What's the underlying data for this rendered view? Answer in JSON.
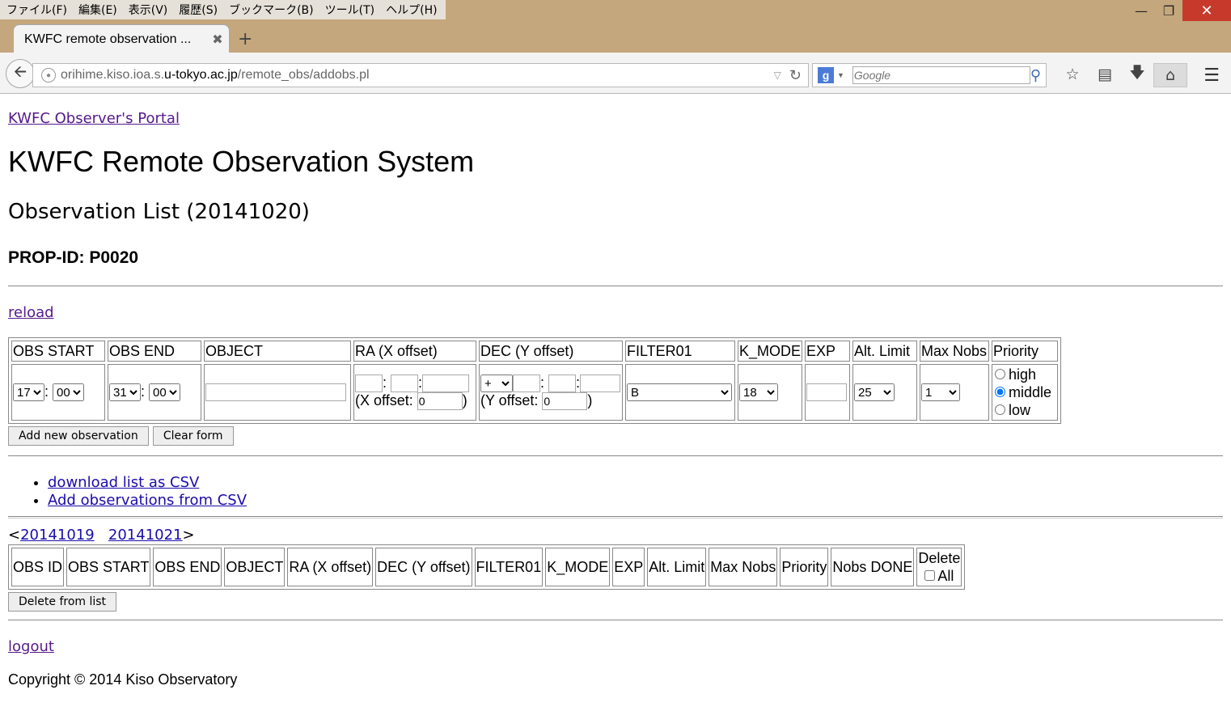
{
  "browser": {
    "menu": [
      "ファイル(F)",
      "編集(E)",
      "表示(V)",
      "履歴(S)",
      "ブックマーク(B)",
      "ツール(T)",
      "ヘルプ(H)"
    ],
    "tab_title": "KWFC remote observation ...",
    "url_host_dim": "orihime.kiso.ioa.s.",
    "url_host": "u-tokyo.ac.jp",
    "url_path": "/remote_obs/addobs.pl",
    "search_placeholder": "Google"
  },
  "page": {
    "portal_link": "KWFC Observer's Portal",
    "title": "KWFC Remote Observation System",
    "subtitle": "Observation List (20141020)",
    "prop_id": "PROP-ID: P0020",
    "reload": "reload"
  },
  "form": {
    "headers": [
      "OBS START",
      "OBS END",
      "OBJECT",
      "RA (X offset)",
      "DEC (Y offset)",
      "FILTER01",
      "K_MODE",
      "EXP",
      "Alt. Limit",
      "Max Nobs",
      "Priority"
    ],
    "obs_start_hour": "17",
    "obs_start_min": "00",
    "obs_end_hour": "31",
    "obs_end_min": "00",
    "x_offset_label": "(X offset:",
    "x_offset_value": "0",
    "dec_sign": "+",
    "y_offset_label": "(Y offset:",
    "y_offset_value": "0",
    "filter": "B",
    "k_mode": "18",
    "alt_limit": "25",
    "max_nobs": "1",
    "priority_options": [
      "high",
      "middle",
      "low"
    ],
    "priority_selected": "middle",
    "colon": ":",
    "close_paren": ")",
    "add_button": "Add new observation",
    "clear_button": "Clear form"
  },
  "links": {
    "download_csv": "download list as CSV",
    "add_from_csv": "Add observations from CSV"
  },
  "list": {
    "prev_date": "20141019",
    "next_date": "20141021",
    "lt": "<",
    "gt": ">",
    "headers": [
      "OBS ID",
      "OBS START",
      "OBS END",
      "OBJECT",
      "RA (X offset)",
      "DEC (Y offset)",
      "FILTER01",
      "K_MODE",
      "EXP",
      "Alt. Limit",
      "Max Nobs",
      "Priority",
      "Nobs DONE"
    ],
    "delete_header": "Delete",
    "delete_all_label": "All",
    "delete_button": "Delete from list"
  },
  "footer": {
    "logout": "logout",
    "copyright": "Copyright © 2014 Kiso Observatory"
  }
}
